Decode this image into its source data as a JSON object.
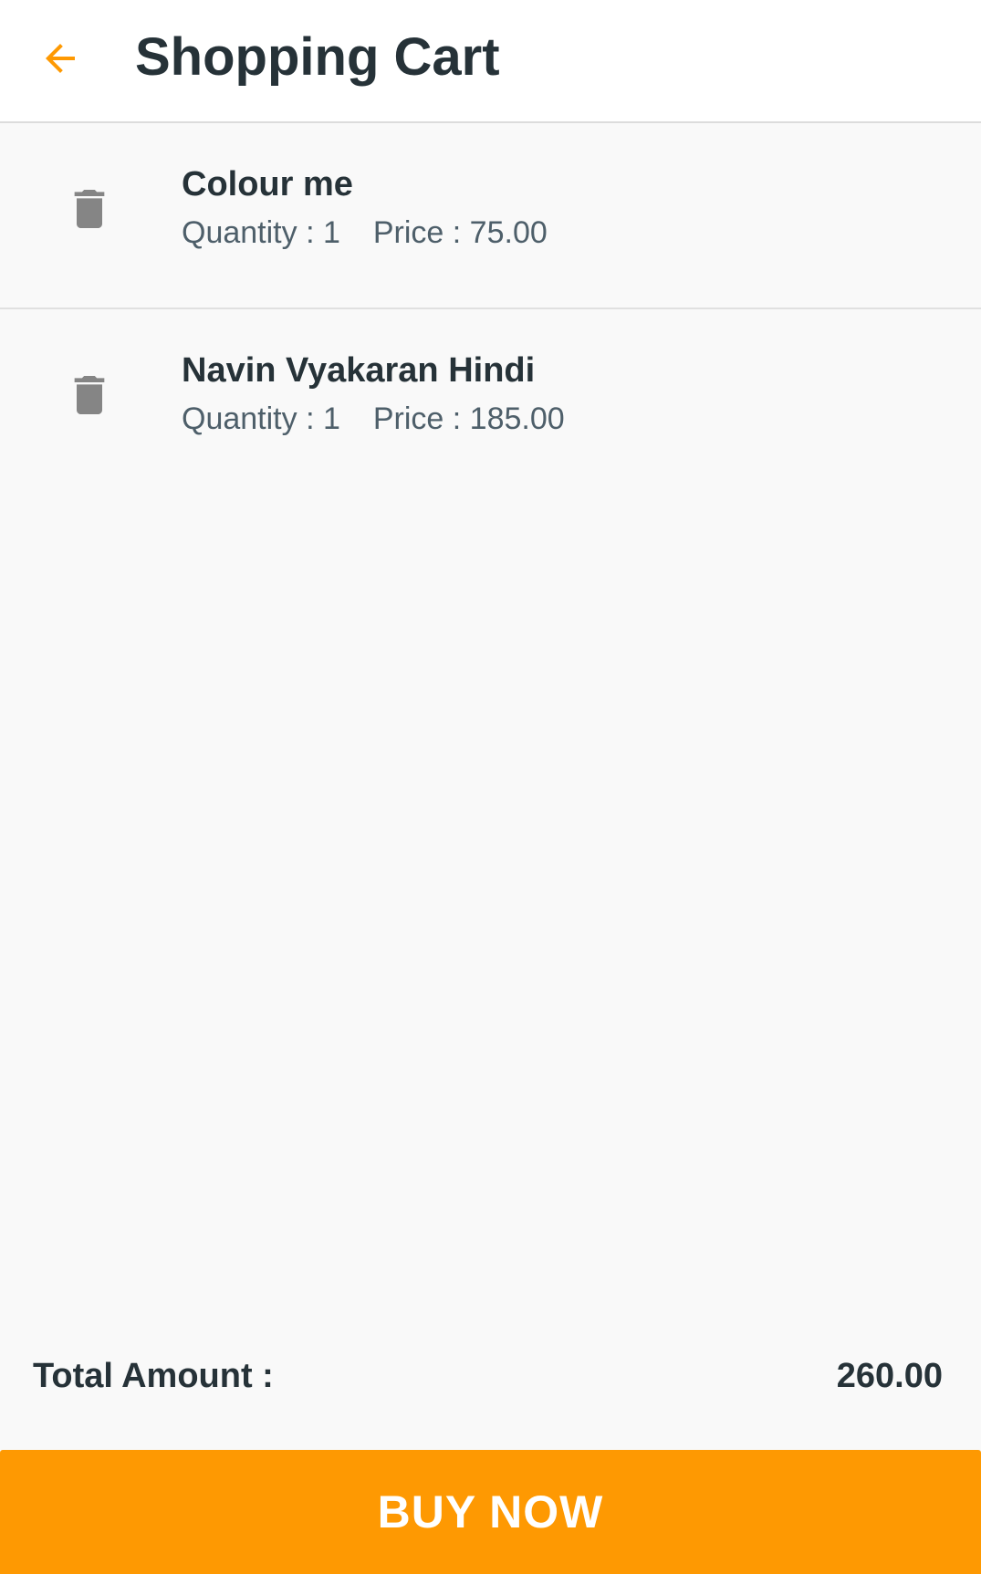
{
  "header": {
    "title": "Shopping Cart",
    "back_icon": "arrow-left-icon",
    "accent_color": "#fe9902"
  },
  "cart": {
    "items": [
      {
        "name": "Colour me",
        "quantity_text": "Quantity : 1",
        "price_text": "Price : 75.00",
        "delete_icon": "trash-icon"
      },
      {
        "name": "Navin Vyakaran Hindi",
        "quantity_text": "Quantity : 1",
        "price_text": "Price : 185.00",
        "delete_icon": "trash-icon"
      }
    ]
  },
  "summary": {
    "total_label": "Total Amount :",
    "total_value": "260.00"
  },
  "actions": {
    "buy_now_label": "BUY NOW",
    "buy_now_color": "#fe9902"
  }
}
